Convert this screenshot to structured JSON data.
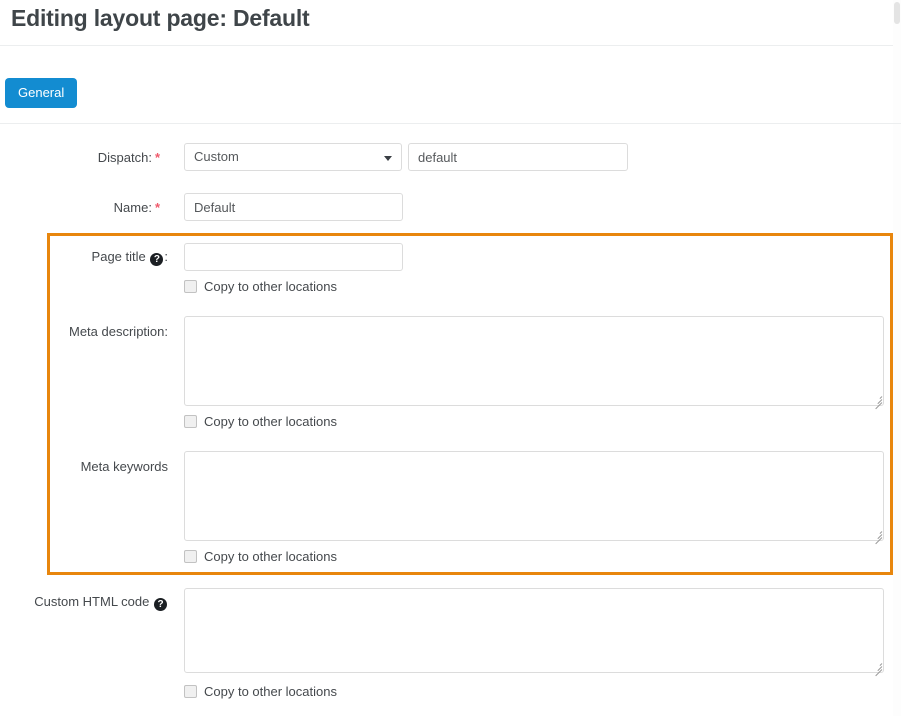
{
  "header": {
    "title": "Editing layout page: Default"
  },
  "tabs": [
    {
      "label": "General",
      "active": true
    }
  ],
  "icons": {
    "help": "?",
    "dropdown_caret": "chevron-down-icon",
    "resize_grip": "resize-handle-icon"
  },
  "colors": {
    "tab_active_bg": "#138cd1",
    "highlight_border": "#e8860d",
    "required_asterisk": "#ef5a6c",
    "label_text": "#45494d",
    "input_border": "#dcdcdc",
    "help_icon_bg": "#1b1f23"
  },
  "form": {
    "dispatch": {
      "label": "Dispatch:",
      "required": "*",
      "select_value": "Custom",
      "text_value": "default",
      "text_placeholder": ""
    },
    "name": {
      "label": "Name:",
      "required": "*",
      "value": "Default",
      "placeholder": ""
    },
    "page_title": {
      "label": "Page title",
      "label_suffix": ":",
      "has_help": true,
      "value": "",
      "placeholder": "",
      "copy_label": "Copy to other locations",
      "copy_checked": false
    },
    "meta_description": {
      "label": "Meta description:",
      "has_help": false,
      "value": "",
      "placeholder": "",
      "copy_label": "Copy to other locations",
      "copy_checked": false
    },
    "meta_keywords": {
      "label": "Meta keywords",
      "has_help": false,
      "value": "",
      "placeholder": "",
      "copy_label": "Copy to other locations",
      "copy_checked": false
    },
    "custom_html": {
      "label": "Custom HTML code",
      "has_help": true,
      "value": "",
      "placeholder": "",
      "copy_label": "Copy to other locations",
      "copy_checked": false
    }
  }
}
